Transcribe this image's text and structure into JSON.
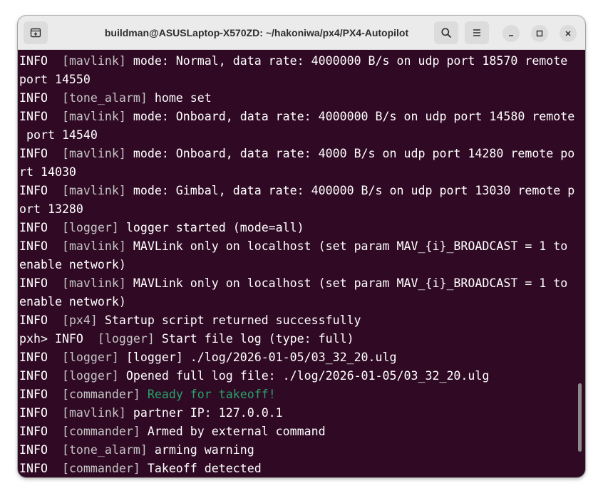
{
  "window": {
    "title": "buildman@ASUSLaptop-X570ZD: ~/hakoniwa/px4/PX4-Autopilot"
  },
  "titlebar_icons": {
    "new_tab": "new-tab-icon",
    "search": "search-icon",
    "menu": "hamburger-menu-icon",
    "minimize": "minimize-icon",
    "maximize": "maximize-icon",
    "close": "close-icon"
  },
  "colors": {
    "terminal_bg": "#300a24",
    "text": "#ffffff",
    "tag_text": "#c5c5c5",
    "ready_green": "#26a269",
    "titlebar_bg": "#ebebeb"
  },
  "terminal": {
    "lines": [
      [
        "INFO  ",
        "[mavlink]",
        " mode: Normal, data rate: 4000000 B/s on udp port 18570 remote"
      ],
      [
        "port 14550"
      ],
      [
        "INFO  ",
        "[tone_alarm]",
        " home set"
      ],
      [
        "INFO  ",
        "[mavlink]",
        " mode: Onboard, data rate: 4000000 B/s on udp port 14580 remote"
      ],
      [
        " port 14540"
      ],
      [
        "INFO  ",
        "[mavlink]",
        " mode: Onboard, data rate: 4000 B/s on udp port 14280 remote po"
      ],
      [
        "rt 14030"
      ],
      [
        "INFO  ",
        "[mavlink]",
        " mode: Gimbal, data rate: 400000 B/s on udp port 13030 remote p"
      ],
      [
        "ort 13280"
      ],
      [
        "INFO  ",
        "[logger]",
        " logger started (mode=all)"
      ],
      [
        "INFO  ",
        "[mavlink]",
        " MAVLink only on localhost (set param MAV_{i}_BROADCAST = 1 to"
      ],
      [
        "enable network)"
      ],
      [
        "INFO  ",
        "[mavlink]",
        " MAVLink only on localhost (set param MAV_{i}_BROADCAST = 1 to"
      ],
      [
        "enable network)"
      ],
      [
        "INFO  ",
        "[px4]",
        " Startup script returned successfully"
      ],
      [
        "pxh> INFO  ",
        "[logger]",
        " Start file log (type: full)"
      ],
      [
        "INFO  ",
        "[logger]",
        " [logger] ./log/2026-01-05/03_32_20.ulg"
      ],
      [
        "INFO  ",
        "[logger]",
        " Opened full log file: ./log/2026-01-05/03_32_20.ulg"
      ],
      [
        "INFO  ",
        "[commander]",
        " ",
        "Ready for takeoff!"
      ],
      [
        "INFO  ",
        "[mavlink]",
        " partner IP: 127.0.0.1"
      ],
      [
        "INFO  ",
        "[commander]",
        " Armed by external command"
      ],
      [
        "INFO  ",
        "[tone_alarm]",
        " arming warning"
      ],
      [
        "INFO  ",
        "[commander]",
        " Takeoff detected"
      ]
    ]
  }
}
